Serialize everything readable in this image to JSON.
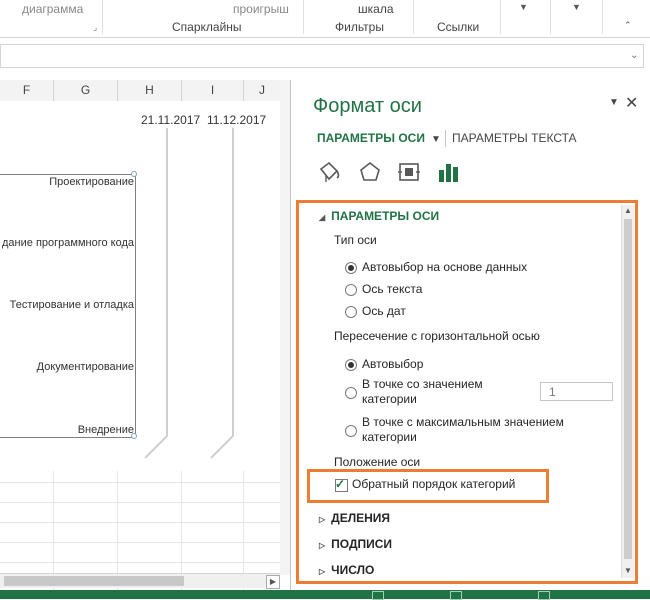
{
  "ribbon": {
    "chart_cmd": "диаграмма",
    "groups": {
      "sparklines": "Спарклайны",
      "filters": "Фильтры",
      "links": "Ссылки"
    },
    "items": {
      "losses": "проигрыш",
      "scale": "шкала"
    }
  },
  "sheet": {
    "columns": [
      "F",
      "G",
      "H",
      "I",
      "J"
    ],
    "dates": [
      "21.11.2017",
      "11.12.2017"
    ],
    "categories": [
      "Проектирование",
      "дание программного кода",
      "Тестирование и отладка",
      "Документирование",
      "Внедрение"
    ]
  },
  "pane": {
    "title": "Формат оси",
    "tabs": {
      "axis_options": "ПАРАМЕТРЫ ОСИ",
      "text_options": "ПАРАМЕТРЫ ТЕКСТА"
    },
    "icons": [
      "fill-line-icon",
      "effects-icon",
      "size-properties-icon",
      "axis-options-icon"
    ],
    "section_axis": "ПАРАМЕТРЫ ОСИ",
    "axis_type": {
      "label": "Тип оси",
      "options": [
        "Автовыбор на основе данных",
        "Ось текста",
        "Ось дат"
      ],
      "selected": 0
    },
    "crossing": {
      "label": "Пересечение с горизонтальной осью",
      "options": [
        "Автовыбор",
        "В точке со значением",
        "категории",
        "В точке с максимальным значением",
        "категории"
      ],
      "selected": 0,
      "value": "1"
    },
    "position": {
      "label": "Положение оси",
      "reverse_label": "Обратный порядок категорий",
      "reverse_checked": true
    },
    "sections": [
      "ДЕЛЕНИЯ",
      "ПОДПИСИ",
      "ЧИСЛО"
    ]
  },
  "colors": {
    "accent": "#217346",
    "highlight": "#ed7d31"
  }
}
